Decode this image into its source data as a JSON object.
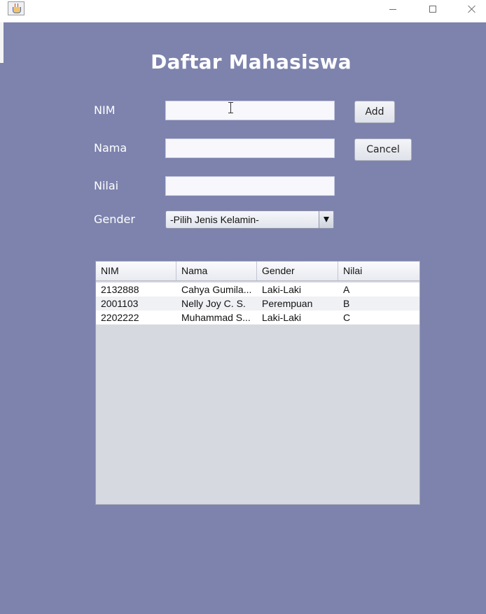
{
  "header": {
    "title": "Daftar Mahasiswa"
  },
  "form": {
    "nim_label": "NIM",
    "nama_label": "Nama",
    "nilai_label": "Nilai",
    "gender_label": "Gender",
    "nim_value": "",
    "nama_value": "",
    "nilai_value": "",
    "gender_selected": "-Pilih Jenis Kelamin-"
  },
  "buttons": {
    "add_label": "Add",
    "cancel_label": "Cancel"
  },
  "table": {
    "columns": [
      "NIM",
      "Nama",
      "Gender",
      "Nilai"
    ],
    "rows": [
      [
        "2132888",
        "Cahya Gumila...",
        "Laki-Laki",
        "A"
      ],
      [
        "2001103",
        "Nelly Joy C. S.",
        "Perempuan",
        "B"
      ],
      [
        "2202222",
        "Muhammad S...",
        "Laki-Laki",
        "C"
      ]
    ]
  },
  "colors": {
    "background": "#7d83ad",
    "title_text": "#ffffff"
  }
}
